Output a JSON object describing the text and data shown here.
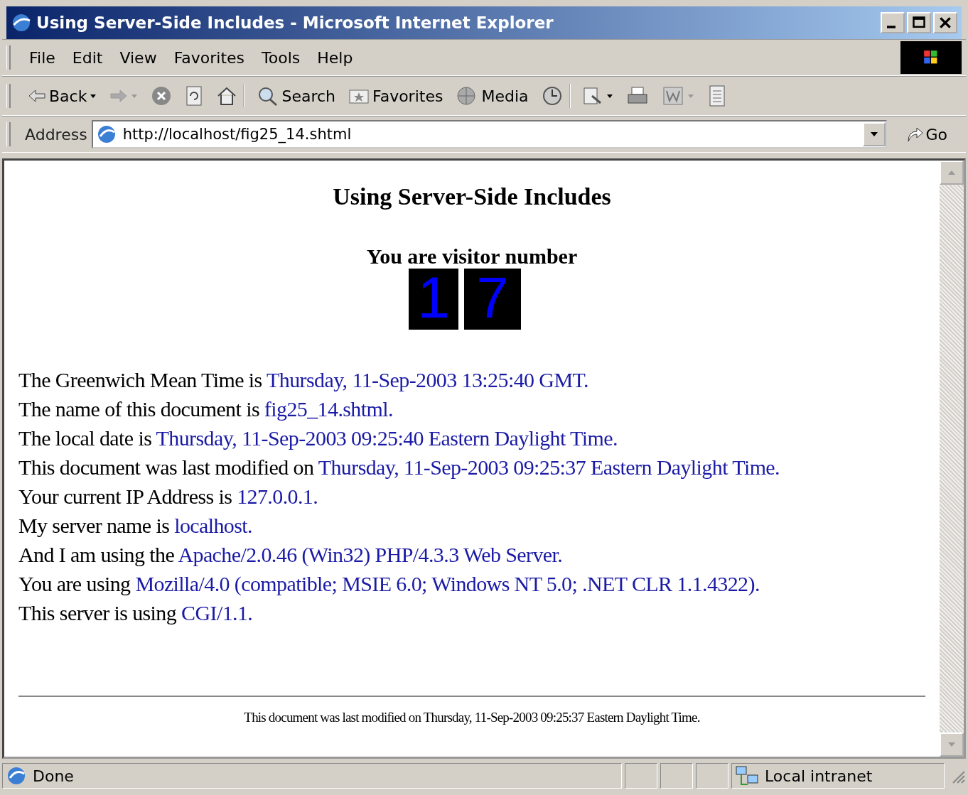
{
  "window": {
    "title": "Using Server-Side Includes - Microsoft Internet Explorer"
  },
  "menu": [
    "File",
    "Edit",
    "View",
    "Favorites",
    "Tools",
    "Help"
  ],
  "toolbar": [
    {
      "kind": "back",
      "label": "Back"
    },
    {
      "kind": "forward"
    },
    {
      "kind": "stop"
    },
    {
      "kind": "refresh"
    },
    {
      "kind": "home"
    },
    {
      "kind": "search",
      "label": "Search"
    },
    {
      "kind": "favorites",
      "label": "Favorites"
    },
    {
      "kind": "media",
      "label": "Media"
    },
    {
      "kind": "history"
    },
    {
      "kind": "mail"
    },
    {
      "kind": "print"
    },
    {
      "kind": "edit"
    },
    {
      "kind": "discuss"
    }
  ],
  "address": {
    "label": "Address",
    "value": "http://localhost/fig25_14.shtml",
    "go": "Go"
  },
  "page": {
    "heading": "Using Server-Side Includes",
    "visitor_label": "You are visitor number",
    "digits": [
      "1",
      "7"
    ],
    "lines": [
      {
        "text": "The Greenwich Mean Time is ",
        "value": "Thursday, 11-Sep-2003 13:25:40 GMT."
      },
      {
        "text": "The name of this document is ",
        "value": "fig25_14.shtml."
      },
      {
        "text": "The local date is ",
        "value": "Thursday, 11-Sep-2003 09:25:40 Eastern Daylight Time."
      },
      {
        "text": "This document was last modified on ",
        "value": "Thursday, 11-Sep-2003 09:25:37 Eastern Daylight Time."
      },
      {
        "text": "Your current IP Address is ",
        "value": "127.0.0.1."
      },
      {
        "text": "My server name is ",
        "value": "localhost."
      },
      {
        "text": "And I am using the ",
        "value": "Apache/2.0.46 (Win32) PHP/4.3.3 Web Server."
      },
      {
        "text": "You are using ",
        "value": "Mozilla/4.0 (compatible; MSIE 6.0; Windows NT 5.0; .NET CLR 1.1.4322)."
      },
      {
        "text": "This server is using ",
        "value": "CGI/1.1."
      }
    ],
    "footer": "This document was last modified on Thursday, 11-Sep-2003 09:25:37 Eastern Daylight Time."
  },
  "status_bar": {
    "text": "Done",
    "zone": "Local intranet"
  }
}
